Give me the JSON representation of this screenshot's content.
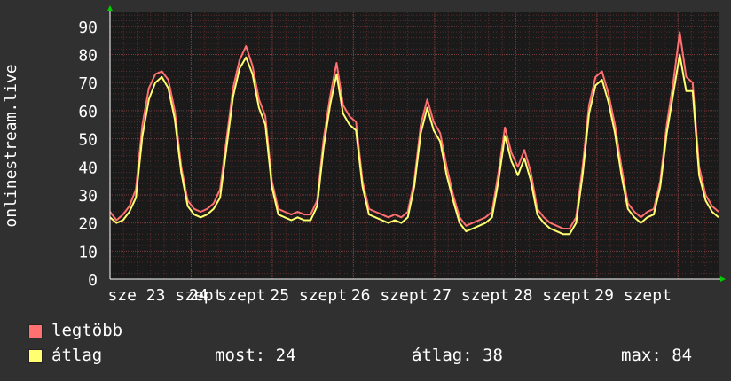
{
  "chart_data": {
    "type": "line",
    "ylabel": "onlinestream.live",
    "ylim": [
      0,
      95
    ],
    "yticks": [
      0,
      10,
      20,
      30,
      40,
      50,
      60,
      70,
      80,
      90
    ],
    "xlim": [
      0,
      7.5
    ],
    "x_tick_labels": [
      "sze 23 szept",
      "24 szept",
      "25 szept",
      "26 szept",
      "27 szept",
      "28 szept",
      "29 szept"
    ],
    "grid": true,
    "series": [
      {
        "name": "legtöbb",
        "color": "#ff7070",
        "values": [
          24,
          21,
          23,
          26,
          32,
          55,
          68,
          73,
          74,
          71,
          60,
          40,
          28,
          25,
          24,
          25,
          27,
          32,
          50,
          68,
          78,
          83,
          76,
          64,
          58,
          35,
          25,
          24,
          23,
          24,
          23,
          23,
          28,
          50,
          65,
          77,
          62,
          58,
          56,
          35,
          25,
          24,
          23,
          22,
          23,
          22,
          24,
          35,
          55,
          64,
          56,
          52,
          40,
          30,
          22,
          19,
          20,
          21,
          22,
          24,
          38,
          54,
          45,
          40,
          46,
          38,
          25,
          22,
          20,
          19,
          18,
          18,
          22,
          40,
          62,
          72,
          74,
          66,
          55,
          40,
          27,
          24,
          22,
          24,
          25,
          35,
          55,
          70,
          88,
          72,
          70,
          40,
          30,
          26,
          24
        ]
      },
      {
        "name": "átlag",
        "color": "#ffff70",
        "values": [
          22,
          20,
          21,
          24,
          29,
          51,
          64,
          70,
          72,
          68,
          57,
          38,
          26,
          23,
          22,
          23,
          25,
          29,
          47,
          65,
          75,
          79,
          73,
          61,
          55,
          33,
          23,
          22,
          21,
          22,
          21,
          21,
          26,
          47,
          62,
          73,
          59,
          55,
          53,
          33,
          23,
          22,
          21,
          20,
          21,
          20,
          22,
          33,
          52,
          61,
          53,
          49,
          37,
          28,
          20,
          17,
          18,
          19,
          20,
          22,
          35,
          51,
          42,
          37,
          43,
          35,
          23,
          20,
          18,
          17,
          16,
          16,
          20,
          37,
          59,
          69,
          71,
          63,
          52,
          37,
          25,
          22,
          20,
          22,
          23,
          33,
          52,
          66,
          80,
          67,
          67,
          37,
          28,
          24,
          22
        ]
      }
    ]
  },
  "legend": {
    "max_label": "legtöbb",
    "avg_label": "átlag",
    "now": "most: 24",
    "avg": "átlag: 38",
    "max": "max: 84"
  },
  "colors": {
    "background": "#303030",
    "plot_background": "#1a1a1a",
    "grid_minor": "#5a2a2a",
    "grid_major": "#7a3a3a",
    "axis_arrow": "#00cc00"
  }
}
